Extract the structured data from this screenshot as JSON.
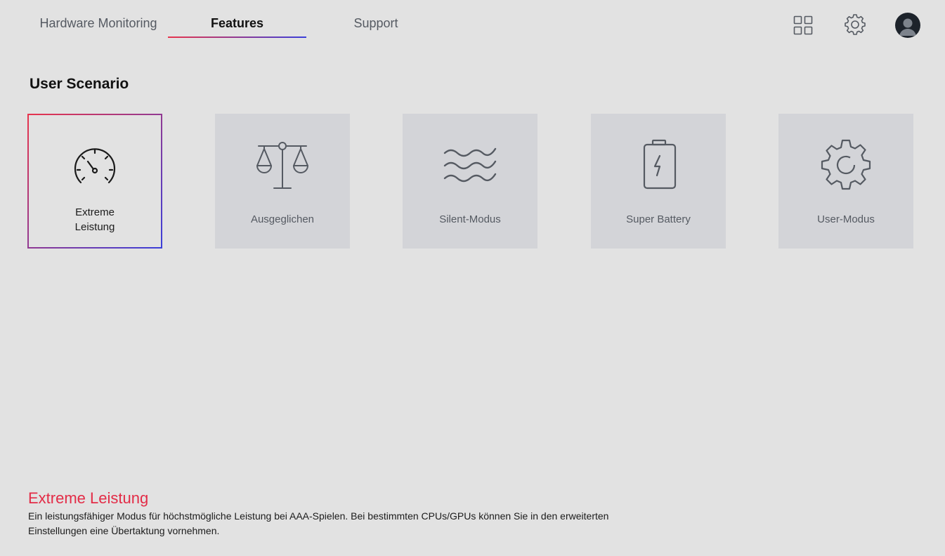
{
  "nav": {
    "tabs": [
      {
        "label": "Hardware Monitoring",
        "active": false
      },
      {
        "label": "Features",
        "active": true
      },
      {
        "label": "Support",
        "active": false
      }
    ]
  },
  "header_icons": [
    "grid-icon",
    "gear-icon",
    "avatar-icon"
  ],
  "section": {
    "title": "User Scenario"
  },
  "scenarios": [
    {
      "label": "Extreme\nLeistung",
      "icon": "speedometer-icon",
      "selected": true
    },
    {
      "label": "Ausgeglichen",
      "icon": "balance-scale-icon",
      "selected": false
    },
    {
      "label": "Silent-Modus",
      "icon": "waves-icon",
      "selected": false
    },
    {
      "label": "Super Battery",
      "icon": "battery-bolt-icon",
      "selected": false
    },
    {
      "label": "User-Modus",
      "icon": "gear-icon",
      "selected": false
    }
  ],
  "description": {
    "title": "Extreme Leistung",
    "text": "Ein leistungsfähiger Modus für höchstmögliche Leistung bei AAA-Spielen. Bei bestimmten CPUs/GPUs können Sie in den erweiterten Einstellungen eine Übertaktung vornehmen."
  },
  "colors": {
    "background": "#e2e2e2",
    "card": "#d3d4d8",
    "accent_red": "#e8344c",
    "accent_blue": "#3a3fd9",
    "description_title": "#e32c47"
  }
}
